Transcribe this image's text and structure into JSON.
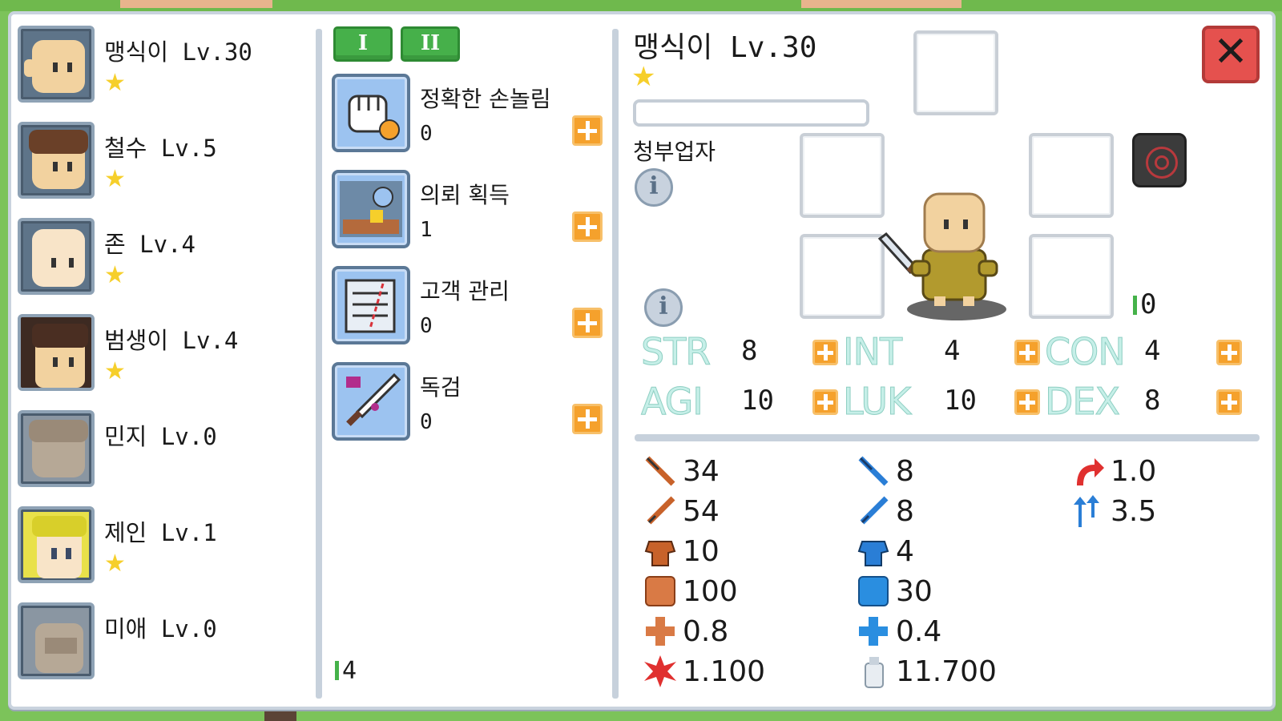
{
  "characters": [
    {
      "name": "맹식이 Lv.30",
      "star": "★",
      "portrait": "bald-face"
    },
    {
      "name": "철수 Lv.5",
      "star": "★",
      "portrait": "brown-hair-face"
    },
    {
      "name": "존 Lv.4",
      "star": "★",
      "portrait": "bald-face"
    },
    {
      "name": "범생이 Lv.4",
      "star": "★",
      "portrait": "dark-hair-face"
    },
    {
      "name": "민지 Lv.0",
      "star": "",
      "portrait": "locked-face"
    },
    {
      "name": "제인 Lv.1",
      "star": "★",
      "portrait": "blonde-face"
    },
    {
      "name": "미애 Lv.0",
      "star": "",
      "portrait": "locked-face"
    }
  ],
  "skill_tabs": [
    "I",
    "II"
  ],
  "skills": [
    {
      "name": "정확한 손놀림",
      "count": "0",
      "icon": "fist-icon"
    },
    {
      "name": "의뢰 획득",
      "count": "1",
      "icon": "request-icon"
    },
    {
      "name": "고객 관리",
      "count": "0",
      "icon": "scroll-icon"
    },
    {
      "name": "독검",
      "count": "0",
      "icon": "poison-sword-icon"
    }
  ],
  "skill_points": "4",
  "detail": {
    "name": "맹식이 Lv.30",
    "star": "★",
    "job": "청부업자",
    "info_symbol": "i",
    "close_symbol": "✕",
    "stat_points": "0"
  },
  "stats": [
    {
      "label": "STR",
      "value": "8"
    },
    {
      "label": "INT",
      "value": "4"
    },
    {
      "label": "CON",
      "value": "4"
    },
    {
      "label": "AGI",
      "value": "10"
    },
    {
      "label": "LUK",
      "value": "10"
    },
    {
      "label": "DEX",
      "value": "8"
    }
  ],
  "derived": {
    "col1": [
      {
        "icon": "physical-attack-icon",
        "value": "34"
      },
      {
        "icon": "physical-sword-icon",
        "value": "54"
      },
      {
        "icon": "physical-armor-icon",
        "value": "10"
      },
      {
        "icon": "hp-icon",
        "value": "100"
      },
      {
        "icon": "hp-regen-icon",
        "value": "0.8"
      },
      {
        "icon": "crit-icon",
        "value": "1.100"
      }
    ],
    "col2": [
      {
        "icon": "magic-attack-icon",
        "value": "8"
      },
      {
        "icon": "magic-sword-icon",
        "value": "8"
      },
      {
        "icon": "magic-armor-icon",
        "value": "4"
      },
      {
        "icon": "mp-icon",
        "value": "30"
      },
      {
        "icon": "mp-regen-icon",
        "value": "0.4"
      },
      {
        "icon": "weight-icon",
        "value": "11.700"
      }
    ],
    "col3": [
      {
        "icon": "attack-speed-icon",
        "value": "1.0"
      },
      {
        "icon": "move-speed-icon",
        "value": "3.5"
      }
    ]
  },
  "colors": {
    "accent_green": "#46b04a",
    "plus_orange": "#f5a12c",
    "close_red": "#e5514e",
    "stat_label": "#c6efe8",
    "star_yellow": "#f6cf2b"
  }
}
